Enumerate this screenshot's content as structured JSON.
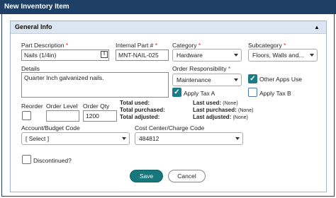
{
  "window": {
    "title": "New Inventory Item"
  },
  "section": {
    "title": "General Info"
  },
  "fields": {
    "part_description": {
      "label": "Part Description",
      "value": "Nails (1/4in)"
    },
    "internal_part": {
      "label": "Internal Part #",
      "value": "MNT-NAIL-025"
    },
    "category": {
      "label": "Category",
      "value": "Hardware"
    },
    "subcategory": {
      "label": "Subcategory",
      "value": "Floors, Walls and..."
    },
    "details": {
      "label": "Details",
      "value": "Quarter Inch galvanized nails."
    },
    "order_responsibility": {
      "label": "Order Responsibility",
      "value": "Maintenance"
    },
    "other_apps_use": {
      "label": "Other Apps Use",
      "checked": true
    },
    "apply_tax_a": {
      "label": "Apply Tax A",
      "checked": true
    },
    "apply_tax_b": {
      "label": "Apply Tax B",
      "checked": false
    },
    "reorder": {
      "label": "Reorder",
      "checked": false
    },
    "order_level": {
      "label": "Order Level",
      "value": ""
    },
    "order_qty": {
      "label": "Order Qty",
      "value": "1200"
    },
    "account_budget": {
      "label": "Account/Budget Code",
      "value": "[ Select ]"
    },
    "cost_center": {
      "label": "Cost Center/Charge Code",
      "value": "484812"
    },
    "discontinued": {
      "label": "Discontinued?",
      "checked": false
    }
  },
  "stats": {
    "total_used": {
      "label": "Total used:",
      "value": ""
    },
    "total_purchased": {
      "label": "Total purchased:",
      "value": ""
    },
    "total_adjusted": {
      "label": "Total adjusted:",
      "value": ""
    },
    "last_used": {
      "label": "Last used:",
      "value": "(None)"
    },
    "last_purchased": {
      "label": "Last purchased:",
      "value": "(None)"
    },
    "last_adjusted": {
      "label": "Last adjusted:",
      "value": "(None)"
    }
  },
  "buttons": {
    "save": "Save",
    "cancel": "Cancel"
  },
  "required_marker": "*",
  "icons": {
    "collapse": "triangle-up-icon",
    "lookup": "lookup-icon",
    "check": "check-icon",
    "dropdown": "chevron-down-icon"
  }
}
